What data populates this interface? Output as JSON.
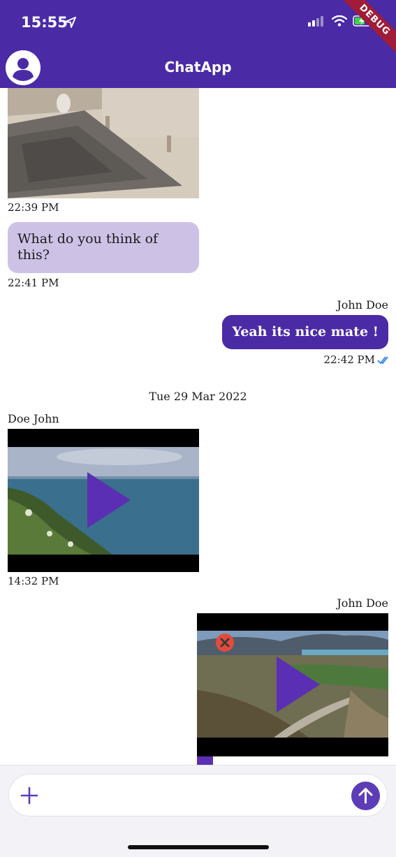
{
  "status_bar": {
    "time": "15:55",
    "debug_label": "DEBUG"
  },
  "app_bar": {
    "title": "ChatApp",
    "color": "#4a2aa5"
  },
  "messages": [
    {
      "type": "image",
      "direction": "incoming",
      "time": "22:39 PM"
    },
    {
      "type": "text",
      "direction": "incoming",
      "text": "What do you think of this?",
      "time": "22:41 PM"
    },
    {
      "type": "text",
      "direction": "outgoing",
      "sender": "John Doe",
      "text": "Yeah its nice mate !",
      "time": "22:42 PM",
      "read": true
    },
    {
      "type": "date_separator",
      "text": "Tue 29 Mar 2022"
    },
    {
      "type": "video",
      "direction": "incoming",
      "sender": "Doe John",
      "time": "14:32 PM"
    },
    {
      "type": "video",
      "direction": "outgoing",
      "sender": "John Doe",
      "upload_failed": true
    }
  ],
  "composer": {
    "placeholder": "",
    "accent": "#5d3cb8"
  }
}
